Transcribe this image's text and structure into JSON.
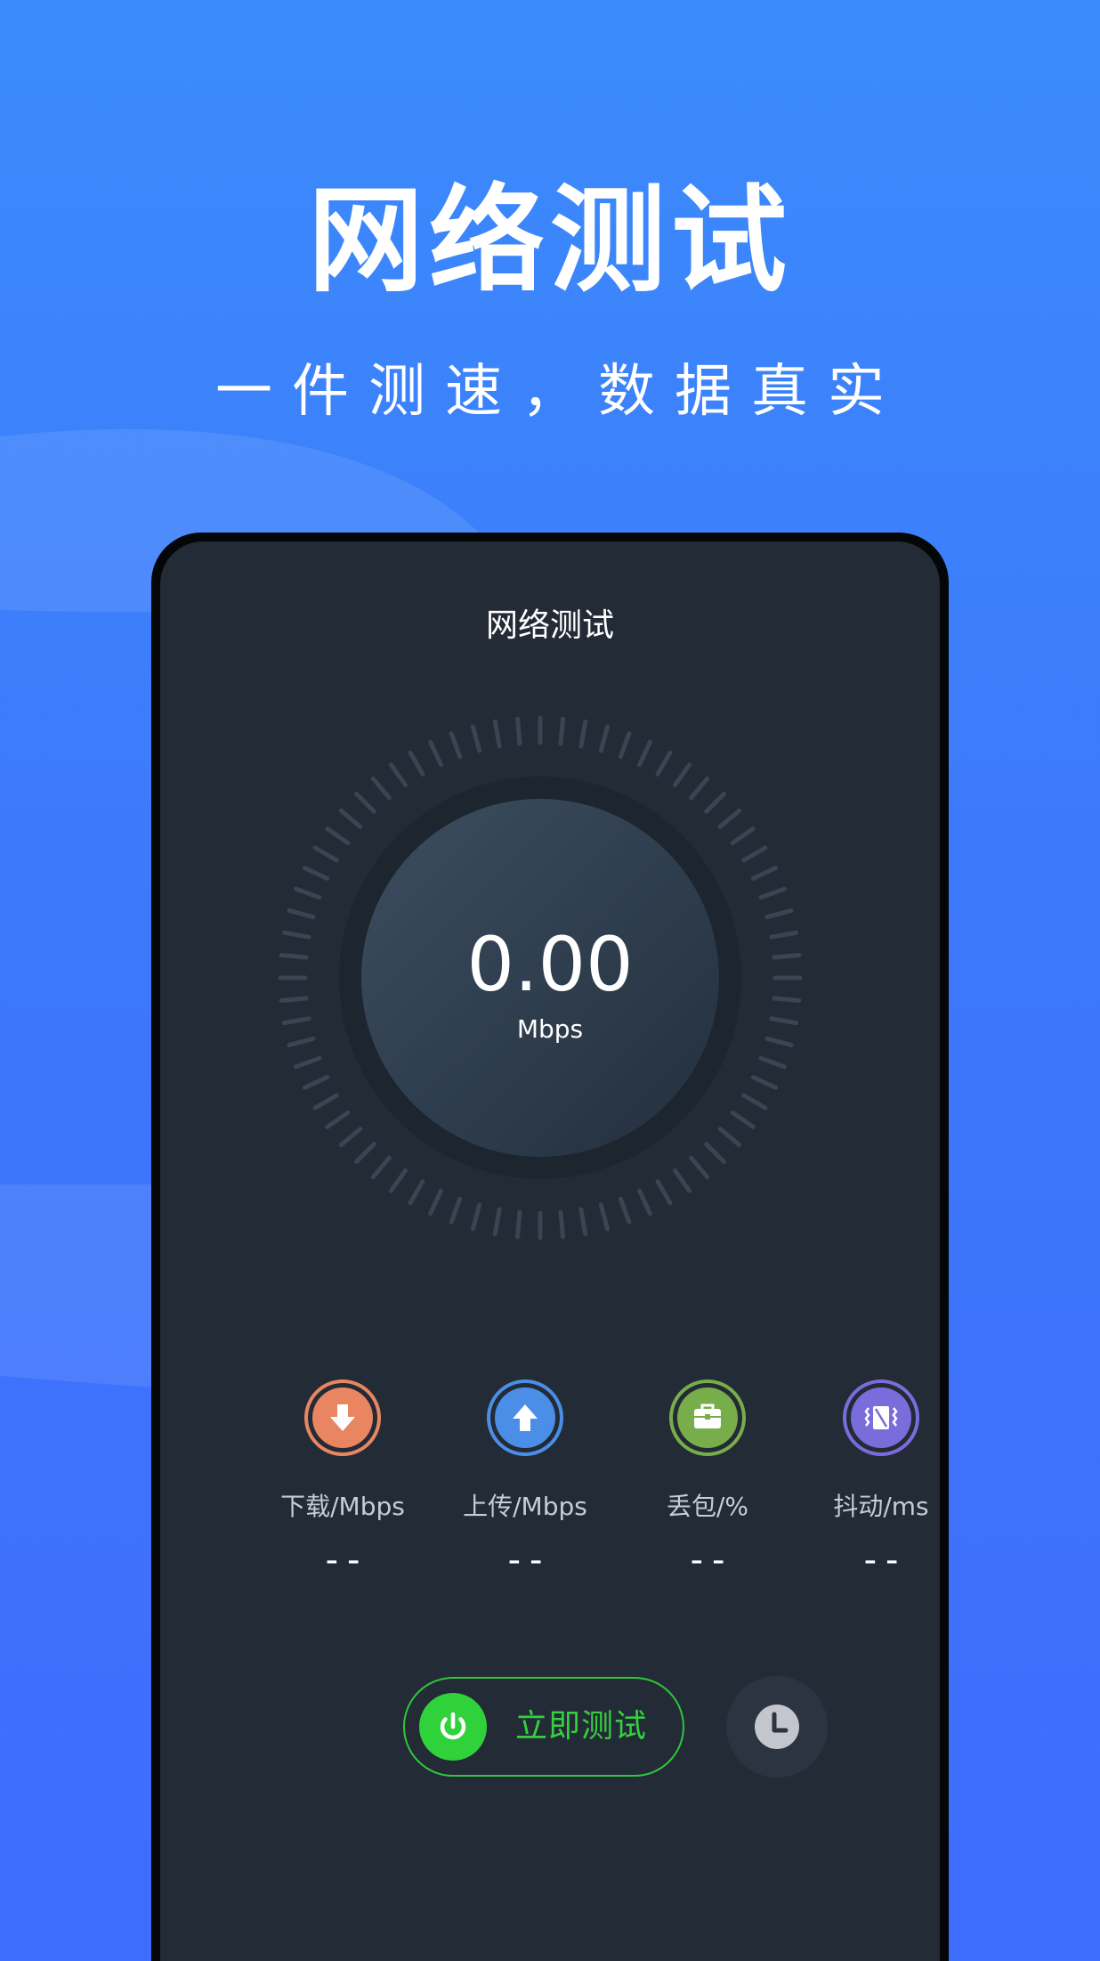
{
  "promo": {
    "headline": "网络测试",
    "subline": "一件测速，数据真实"
  },
  "app": {
    "title": "网络测试",
    "gauge": {
      "value": "0.00",
      "unit": "Mbps"
    },
    "stats": [
      {
        "label": "下载/Mbps",
        "value": "--",
        "icon": "download-icon",
        "color": "#e98661"
      },
      {
        "label": "上传/Mbps",
        "value": "--",
        "icon": "upload-icon",
        "color": "#4a8ee8"
      },
      {
        "label": "丢包/%",
        "value": "--",
        "icon": "briefcase-icon",
        "color": "#78ad4b"
      },
      {
        "label": "抖动/ms",
        "value": "--",
        "icon": "jitter-icon",
        "color": "#7a6ddb"
      }
    ],
    "start_button": {
      "label": "立即测试",
      "icon": "power-icon",
      "color": "#35cf3f"
    },
    "history_button": {
      "icon": "clock-icon"
    }
  },
  "colors": {
    "background_top": "#3c8bfb",
    "background_bottom": "#3e6cfd",
    "screen": "#232b36",
    "accent_green": "#35cf3f"
  }
}
